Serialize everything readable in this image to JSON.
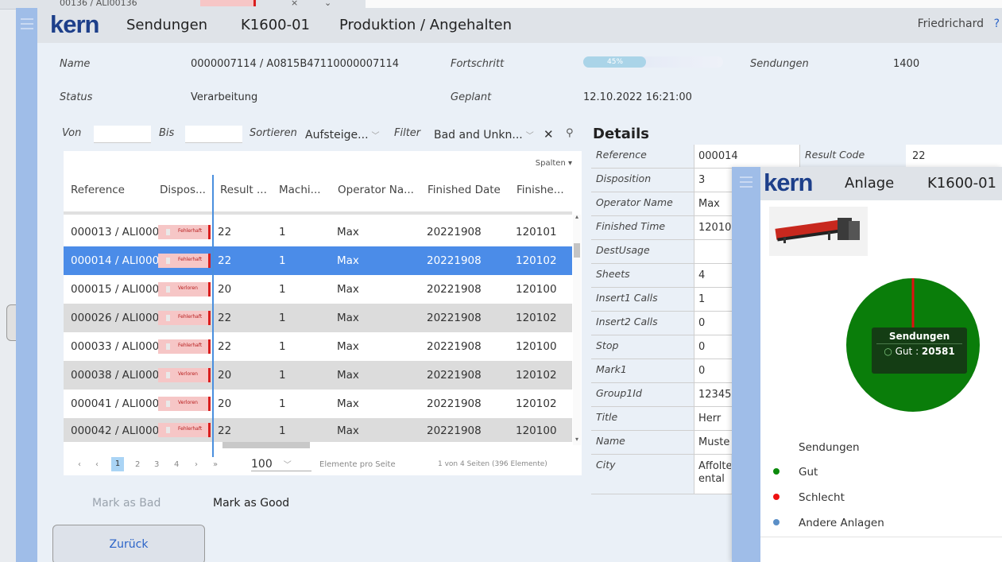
{
  "background": {
    "top_row_text": "00136 / ALI00136"
  },
  "header": {
    "section": "Sendungen",
    "machine": "K1600-01",
    "state": "Produktion / Angehalten",
    "user": "Friedrichard",
    "user_icon": "?"
  },
  "info": {
    "name_label": "Name",
    "name_value": "0000007114 / A0815B47110000007114",
    "progress_label": "Fortschritt",
    "progress_text": "45%",
    "progress_value": 0.45,
    "sendungen_label": "Sendungen",
    "sendungen_value": "1400",
    "status_label": "Status",
    "status_value": "Verarbeitung",
    "geplant_label": "Geplant",
    "geplant_value": "12.10.2022 16:21:00"
  },
  "filters": {
    "von_label": "Von",
    "bis_label": "Bis",
    "sort_label": "Sortieren",
    "sort_value": "Aufsteige...",
    "filter_label": "Filter",
    "filter_value": "Bad and Unkn..."
  },
  "grid": {
    "spalten_label": "Spalten",
    "columns": [
      "Reference",
      "Dispos...",
      "Result ...",
      "Machi...",
      "Operator Na...",
      "Finished Date",
      "Finishe..."
    ],
    "rows": [
      {
        "reference": "000013 / ALI000",
        "disposition": "Fehlerhaft",
        "result": "22",
        "machine": "1",
        "operator": "Max",
        "date": "20221908",
        "time": "120101"
      },
      {
        "reference": "000014 / ALI000",
        "disposition": "Fehlerhaft",
        "result": "22",
        "machine": "1",
        "operator": "Max",
        "date": "20221908",
        "time": "120102"
      },
      {
        "reference": "000015 / ALI000",
        "disposition": "Verloren",
        "result": "20",
        "machine": "1",
        "operator": "Max",
        "date": "20221908",
        "time": "120100"
      },
      {
        "reference": "000026 / ALI000",
        "disposition": "Fehlerhaft",
        "result": "22",
        "machine": "1",
        "operator": "Max",
        "date": "20221908",
        "time": "120102"
      },
      {
        "reference": "000033 / ALI000",
        "disposition": "Fehlerhaft",
        "result": "22",
        "machine": "1",
        "operator": "Max",
        "date": "20221908",
        "time": "120100"
      },
      {
        "reference": "000038 / ALI000",
        "disposition": "Verloren",
        "result": "20",
        "machine": "1",
        "operator": "Max",
        "date": "20221908",
        "time": "120102"
      },
      {
        "reference": "000041 / ALI000",
        "disposition": "Verloren",
        "result": "20",
        "machine": "1",
        "operator": "Max",
        "date": "20221908",
        "time": "120102"
      },
      {
        "reference": "000042 / ALI000",
        "disposition": "Fehlerhaft",
        "result": "22",
        "machine": "1",
        "operator": "Max",
        "date": "20221908",
        "time": "120100"
      }
    ],
    "selected_row": 1,
    "pager": {
      "pages": [
        "1",
        "2",
        "3",
        "4"
      ],
      "page_size": "100",
      "page_size_label": "Elemente pro Seite",
      "summary": "1 von 4 Seiten (396 Elemente)"
    }
  },
  "actions": {
    "mark_bad": "Mark as Bad",
    "mark_good": "Mark as Good",
    "back": "Zurück"
  },
  "details": {
    "title": "Details",
    "rows": [
      {
        "label": "Reference",
        "value": "000014",
        "label2": "Result Code",
        "value2": "22"
      },
      {
        "label": "Disposition",
        "value": "3"
      },
      {
        "label": "Operator Name",
        "value": "Max"
      },
      {
        "label": "Finished Time",
        "value": "12010"
      },
      {
        "label": "DestUsage",
        "value": ""
      },
      {
        "label": "Sheets",
        "value": "4"
      },
      {
        "label": "Insert1 Calls",
        "value": "1"
      },
      {
        "label": "Insert2 Calls",
        "value": "0"
      },
      {
        "label": "Stop",
        "value": "0"
      },
      {
        "label": "Mark1",
        "value": "0"
      },
      {
        "label": "Group1Id",
        "value": "12345"
      },
      {
        "label": "Title",
        "value": "Herr"
      },
      {
        "label": "Name",
        "value": "Muste"
      },
      {
        "label": "City",
        "value": "Affolte ental"
      }
    ]
  },
  "overlay": {
    "section": "Anlage",
    "machine": "K1600-01",
    "tooltip_title": "Sendungen",
    "tooltip_label": "Gut : ",
    "tooltip_value": "20581",
    "legend_title": "Sendungen",
    "legend": [
      {
        "label": "Gut",
        "color": "#0c8a0c"
      },
      {
        "label": "Schlecht",
        "color": "#ee1111"
      },
      {
        "label": "Andere Anlagen",
        "color": "#5b8fc7"
      }
    ]
  },
  "chart_data": {
    "type": "pie",
    "title": "Sendungen",
    "slices": [
      {
        "name": "Gut",
        "value": 20581,
        "color": "#0a7d0a"
      },
      {
        "name": "Schlecht",
        "value": 0,
        "color": "#e01010"
      }
    ]
  }
}
